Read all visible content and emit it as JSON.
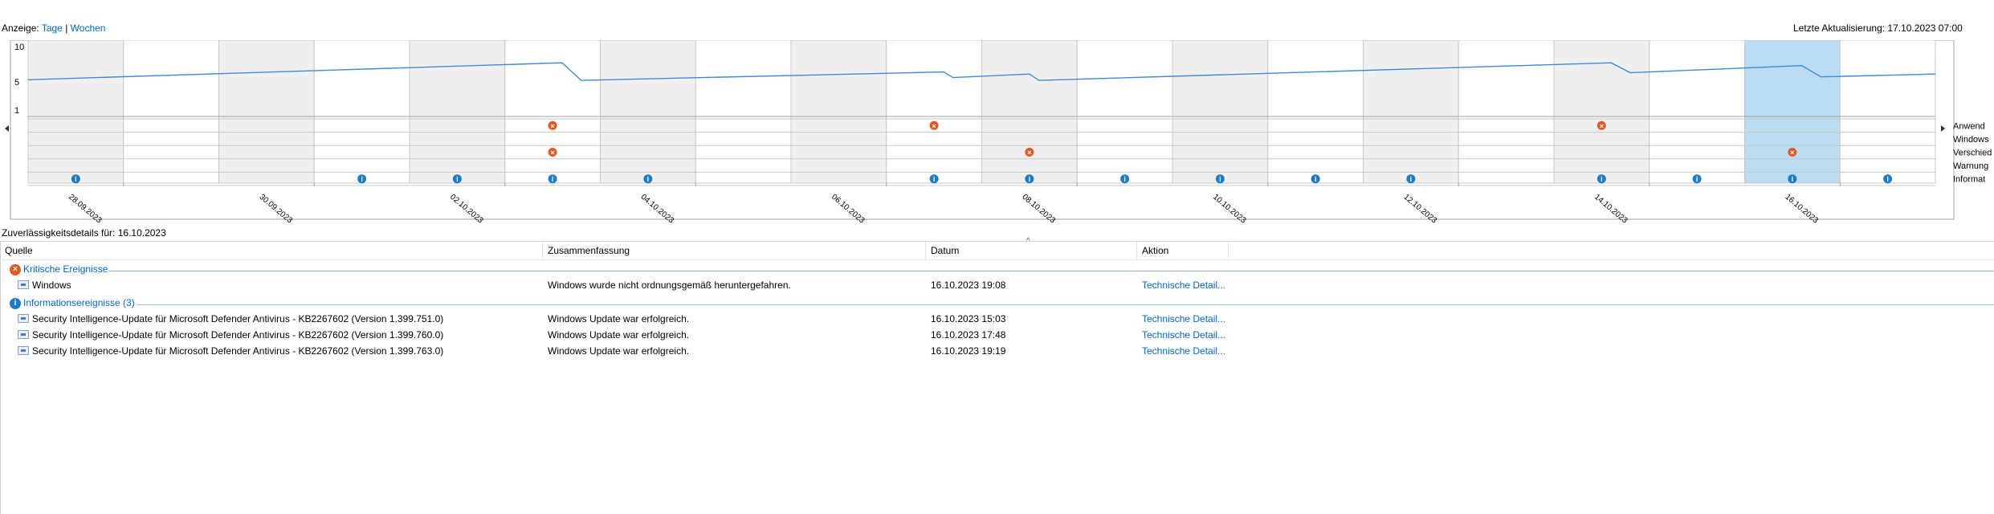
{
  "header": {
    "anzeige_label": "Anzeige:",
    "tage_link": "Tage",
    "separator": "|",
    "wochen_link": "Wochen",
    "last_update": "Letzte Aktualisierung: 17.10.2023 07:00"
  },
  "chart_data": {
    "type": "line",
    "y_ticks": [
      "10",
      "5",
      "1"
    ],
    "ylim": [
      1,
      10
    ],
    "days": [
      "28.09.2023",
      "29.09.2023",
      "30.09.2023",
      "01.10.2023",
      "02.10.2023",
      "03.10.2023",
      "04.10.2023",
      "05.10.2023",
      "06.10.2023",
      "07.10.2023",
      "08.10.2023",
      "09.10.2023",
      "10.10.2023",
      "11.10.2023",
      "12.10.2023",
      "13.10.2023",
      "14.10.2023",
      "15.10.2023",
      "16.10.2023",
      "17.10.2023"
    ],
    "date_labels": [
      "28.09.2023",
      "30.09.2023",
      "02.10.2023",
      "04.10.2023",
      "06.10.2023",
      "08.10.2023",
      "10.10.2023",
      "12.10.2023",
      "14.10.2023",
      "16.10.2023"
    ],
    "stability_index": [
      [
        0,
        5.3
      ],
      [
        5.6,
        7.7
      ],
      [
        5.8,
        5.2
      ],
      [
        9.6,
        6.4
      ],
      [
        9.7,
        5.6
      ],
      [
        10.5,
        6.1
      ],
      [
        10.6,
        5.2
      ],
      [
        16.6,
        7.7
      ],
      [
        16.8,
        6.3
      ],
      [
        18.6,
        7.3
      ],
      [
        18.8,
        5.7
      ],
      [
        20,
        6.1
      ]
    ],
    "selected_day": "16.10.2023",
    "categories": [
      "Anwendungsfehler",
      "Windows-Fehler",
      "Verschiedene Fehler",
      "Warnungen",
      "Informationsereignisse"
    ],
    "category_labels_visible": [
      "Anwend",
      "Windows",
      "Verschied",
      "Warnung",
      "Informat"
    ],
    "events": {
      "Anwendungsfehler": [
        "03.10.2023",
        "07.10.2023",
        "14.10.2023"
      ],
      "Windows-Fehler": [],
      "Verschiedene Fehler": [
        "03.10.2023",
        "08.10.2023",
        "16.10.2023"
      ],
      "Warnungen": [],
      "Informationsereignisse": [
        "28.09.2023",
        "01.10.2023",
        "02.10.2023",
        "03.10.2023",
        "04.10.2023",
        "07.10.2023",
        "08.10.2023",
        "09.10.2023",
        "10.10.2023",
        "11.10.2023",
        "12.10.2023",
        "14.10.2023",
        "15.10.2023",
        "16.10.2023",
        "17.10.2023"
      ]
    },
    "nav_left_icon": "triangle-left-icon",
    "nav_right_icon": "triangle-right-icon"
  },
  "details": {
    "label": "Zuverlässigkeitsdetails für: 16.10.2023",
    "columns": [
      "Quelle",
      "Zusammenfassung",
      "Datum",
      "Aktion"
    ],
    "groups": [
      {
        "title": "Kritische Ereignisse",
        "icon": "error-icon",
        "rows": [
          {
            "source": "Windows",
            "summary": "Windows wurde nicht ordnungsgemäß heruntergefahren.",
            "date": "16.10.2023 19:08",
            "action": "Technische Detail..."
          }
        ]
      },
      {
        "title": "Informationsereignisse (3)",
        "icon": "info-icon",
        "rows": [
          {
            "source": "Security Intelligence-Update für Microsoft Defender Antivirus - KB2267602 (Version 1.399.751.0)",
            "summary": "Windows Update war erfolgreich.",
            "date": "16.10.2023 15:03",
            "action": "Technische Detail..."
          },
          {
            "source": "Security Intelligence-Update für Microsoft Defender Antivirus - KB2267602 (Version 1.399.760.0)",
            "summary": "Windows Update war erfolgreich.",
            "date": "16.10.2023 17:48",
            "action": "Technische Detail..."
          },
          {
            "source": "Security Intelligence-Update für Microsoft Defender Antivirus - KB2267602 (Version 1.399.763.0)",
            "summary": "Windows Update war erfolgreich.",
            "date": "16.10.2023 19:19",
            "action": "Technische Detail..."
          }
        ]
      }
    ]
  },
  "colors": {
    "line": "#3c8ad8",
    "selected": "#bcdcf4",
    "shade": "#efefef",
    "error": "#e05a28",
    "info": "#1f7bc4",
    "grid": "#c8c8c8"
  }
}
